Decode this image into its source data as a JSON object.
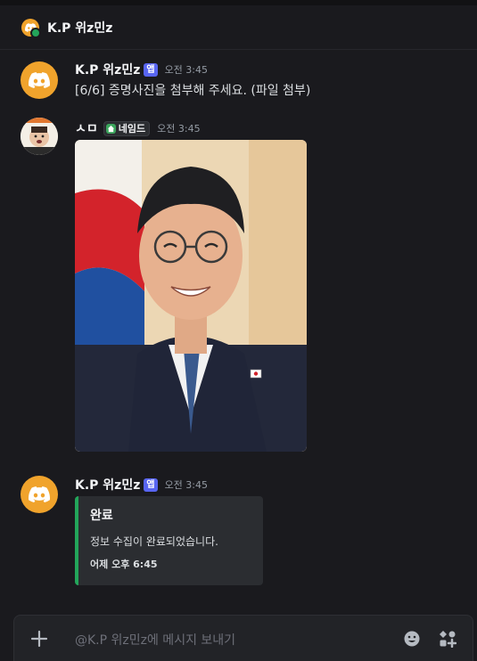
{
  "channel": {
    "title": "K.P 위z민z"
  },
  "messages": [
    {
      "author": "K.P 위z민z",
      "badge": "앱",
      "time": "오전 3:45",
      "text": "[6/6] 증명사진을 첨부해 주세요. (파일 첨부)"
    },
    {
      "author": "ㅅㅁ",
      "tag": "네임드",
      "time": "오전 3:45",
      "attachment": "photo"
    },
    {
      "author": "K.P 위z민z",
      "badge": "앱",
      "time": "오전 3:45",
      "embed": {
        "title": "완료",
        "description": "정보 수집이 완료되었습니다.",
        "footer": "어제 오후 6:45",
        "accent": "#23a55a"
      }
    }
  ],
  "composer": {
    "placeholder": "@K.P 위z민z에 메시지 보내기"
  },
  "colors": {
    "background": "#1a1a1e",
    "brand": "#5865f2",
    "bot_avatar": "#f0a32c"
  }
}
